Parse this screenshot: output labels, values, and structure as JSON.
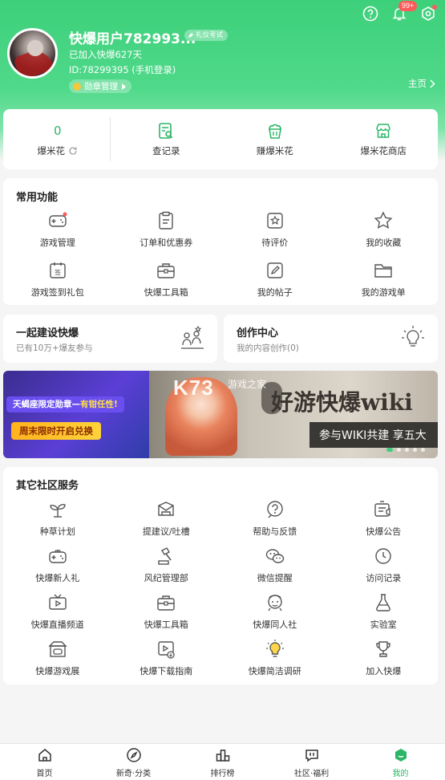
{
  "header": {
    "username": "快爆用户782993...",
    "level_tag": "礼仪考试",
    "joined": "已加入快爆627天",
    "uid": "ID:78299395 (手机登录)",
    "medal_label": "勋章管理",
    "home_link": "主页",
    "notification_badge": "99+"
  },
  "stats": [
    {
      "value": "0",
      "label": "爆米花",
      "icon": "refresh-icon"
    },
    {
      "label": "查记录",
      "icon": "record-search-icon"
    },
    {
      "label": "赚爆米花",
      "icon": "popcorn-icon"
    },
    {
      "label": "爆米花商店",
      "icon": "store-icon"
    }
  ],
  "common": {
    "title": "常用功能",
    "items": [
      {
        "label": "游戏管理",
        "icon": "gamepad-icon"
      },
      {
        "label": "订单和优惠券",
        "icon": "clipboard-icon"
      },
      {
        "label": "待评价",
        "icon": "rating-icon"
      },
      {
        "label": "我的收藏",
        "icon": "star-icon"
      },
      {
        "label": "游戏签到礼包",
        "icon": "calendar-sign-icon"
      },
      {
        "label": "快爆工具箱",
        "icon": "toolbox-icon"
      },
      {
        "label": "我的帖子",
        "icon": "edit-post-icon"
      },
      {
        "label": "我的游戏单",
        "icon": "folder-icon"
      }
    ]
  },
  "build": {
    "title": "一起建设快爆",
    "subtitle": "已有10万+爆友参与"
  },
  "create": {
    "title": "创作中心",
    "subtitle": "我的内容创作(0)"
  },
  "banner": {
    "left_line1a": "天蝎座限定勋章—",
    "left_line1b": "有钳任性!",
    "left_line2": "周末限时开启兑换",
    "k73": "K73",
    "k73_small": "游戏之家",
    "title": "好游快爆wiki",
    "subtitle": "参与WIKI共建 享五大"
  },
  "other": {
    "title": "其它社区服务",
    "items": [
      {
        "label": "种草计划",
        "icon": "sprout-icon"
      },
      {
        "label": "提建议/吐槽",
        "icon": "suggestion-icon"
      },
      {
        "label": "帮助与反馈",
        "icon": "help-icon"
      },
      {
        "label": "快爆公告",
        "icon": "announcement-icon"
      },
      {
        "label": "快爆新人礼",
        "icon": "gift-gamepad-icon"
      },
      {
        "label": "风纪管理部",
        "icon": "gavel-icon"
      },
      {
        "label": "微信提醒",
        "icon": "wechat-icon"
      },
      {
        "label": "访问记录",
        "icon": "clock-icon"
      },
      {
        "label": "快爆直播频道",
        "icon": "live-tv-icon"
      },
      {
        "label": "快爆工具箱",
        "icon": "toolbox-icon"
      },
      {
        "label": "快爆同人社",
        "icon": "fan-art-icon"
      },
      {
        "label": "实验室",
        "icon": "flask-icon"
      },
      {
        "label": "快爆游戏展",
        "icon": "game-expo-icon"
      },
      {
        "label": "快爆下载指南",
        "icon": "download-guide-icon"
      },
      {
        "label": "快爆简洁调研",
        "icon": "lightbulb-icon"
      },
      {
        "label": "加入快爆",
        "icon": "trophy-icon"
      }
    ]
  },
  "tabs": [
    {
      "label": "首页",
      "icon": "home-icon"
    },
    {
      "label": "新奇·分类",
      "icon": "compass-icon"
    },
    {
      "label": "排行榜",
      "icon": "ranking-icon"
    },
    {
      "label": "社区·福利",
      "icon": "community-icon"
    },
    {
      "label": "我的",
      "icon": "profile-icon",
      "active": true
    }
  ],
  "colors": {
    "accent": "#2bb566",
    "header_green": "#3dd07a",
    "badge_red": "#ff5a5a"
  }
}
